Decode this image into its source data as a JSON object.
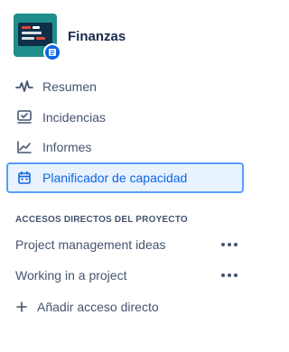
{
  "project": {
    "name": "Finanzas",
    "avatar_icon": "finance-screen-icon",
    "badge_icon": "document-icon"
  },
  "nav": {
    "items": [
      {
        "label": "Resumen",
        "icon": "pulse-icon",
        "active": false
      },
      {
        "label": "Incidencias",
        "icon": "issues-icon",
        "active": false
      },
      {
        "label": "Informes",
        "icon": "chart-icon",
        "active": false
      },
      {
        "label": "Planificador de capacidad",
        "icon": "calendar-icon",
        "active": true
      }
    ]
  },
  "shortcuts": {
    "title": "ACCESOS DIRECTOS DEL PROYECTO",
    "items": [
      {
        "label": "Project management ideas"
      },
      {
        "label": "Working in a project"
      }
    ],
    "add_label": "Añadir acceso directo"
  },
  "colors": {
    "accent": "#0c66e4",
    "active_bg": "#e9f2ff",
    "active_border": "#579dff",
    "text": "#44546f",
    "avatar_bg": "#1f8e8a"
  }
}
